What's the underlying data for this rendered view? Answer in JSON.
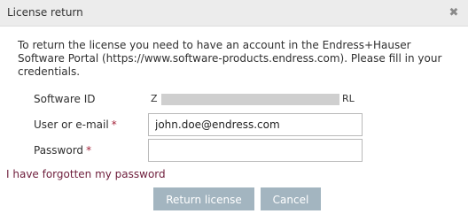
{
  "dialog": {
    "title": "License return",
    "close_icon": "close-x-icon"
  },
  "intro_text": "To return the license you need to have an account in the Endress+Hauser Software Portal (https://www.software-products.endress.com). Please fill in your credentials.",
  "form": {
    "software_id": {
      "label": "Software ID",
      "value_prefix": "Z",
      "value_suffix": "RL"
    },
    "user": {
      "label": "User or e-mail",
      "required_mark": "*",
      "value": "john.doe@endress.com"
    },
    "password": {
      "label": "Password",
      "required_mark": "*",
      "value": ""
    }
  },
  "forgot_password_link": "I have forgotten my password",
  "buttons": {
    "return_license": "Return license",
    "cancel": "Cancel"
  },
  "colors": {
    "title_bar": "#ececec",
    "button": "#a3b5c0",
    "link": "#6e1d3b",
    "required": "#a4243b"
  }
}
